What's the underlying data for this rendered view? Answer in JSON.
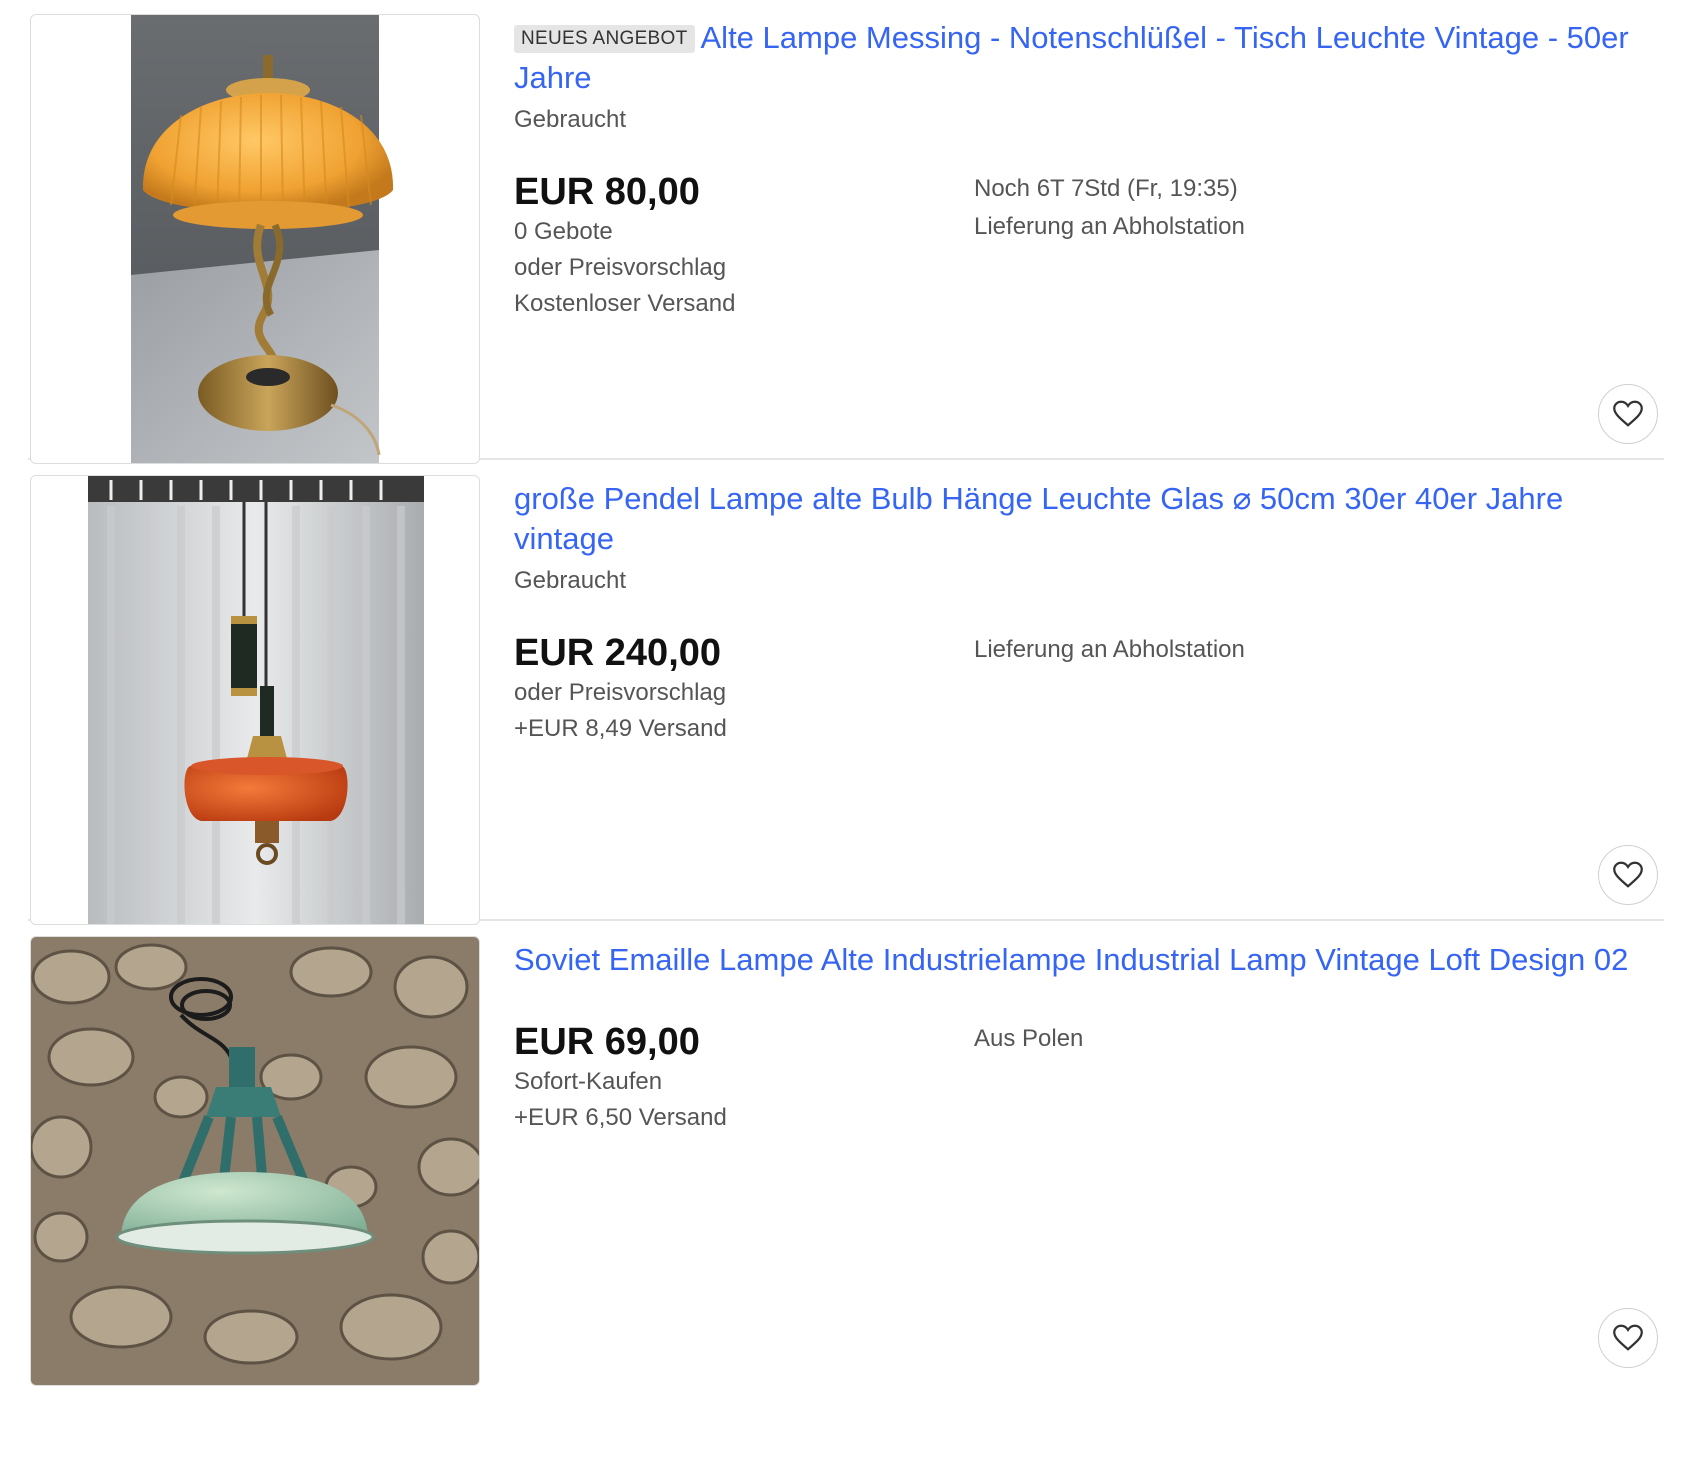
{
  "listings": [
    {
      "badge": "NEUES ANGEBOT",
      "title": "Alte Lampe Messing - Notenschlüßel - Tisch Leuchte Vintage - 50er Jahre",
      "condition": "Gebraucht",
      "price": "EUR 80,00",
      "details": [
        "0 Gebote",
        "oder Preisvorschlag",
        "Kostenloser Versand"
      ],
      "right_details": [
        "Noch 6T 7Std (Fr, 19:35)",
        "Lieferung an Abholstation"
      ],
      "image_icon": "brass-table-lamp-photo",
      "watch_icon": "heart-icon"
    },
    {
      "badge": "",
      "title": "große Pendel Lampe alte Bulb Hänge Leuchte Glas ⌀ 50cm 30er 40er Jahre vintage",
      "condition": "Gebraucht",
      "price": "EUR 240,00",
      "details": [
        "oder Preisvorschlag",
        "+EUR 8,49 Versand"
      ],
      "right_details": [
        "Lieferung an Abholstation"
      ],
      "image_icon": "pendant-lamp-photo",
      "watch_icon": "heart-icon"
    },
    {
      "badge": "",
      "title": "Soviet Emaille Lampe Alte Industrielampe Industrial Lamp Vintage Loft Design 02",
      "condition": "",
      "price": "EUR 69,00",
      "details": [
        "Sofort-Kaufen",
        "+EUR 6,50 Versand"
      ],
      "right_details": [
        "Aus Polen"
      ],
      "image_icon": "industrial-enamel-lamp-photo",
      "watch_icon": "heart-icon"
    }
  ],
  "colors": {
    "link": "#3665f3",
    "price": "#111111",
    "secondary_text": "#555555",
    "badge_bg": "#e5e5e5"
  }
}
